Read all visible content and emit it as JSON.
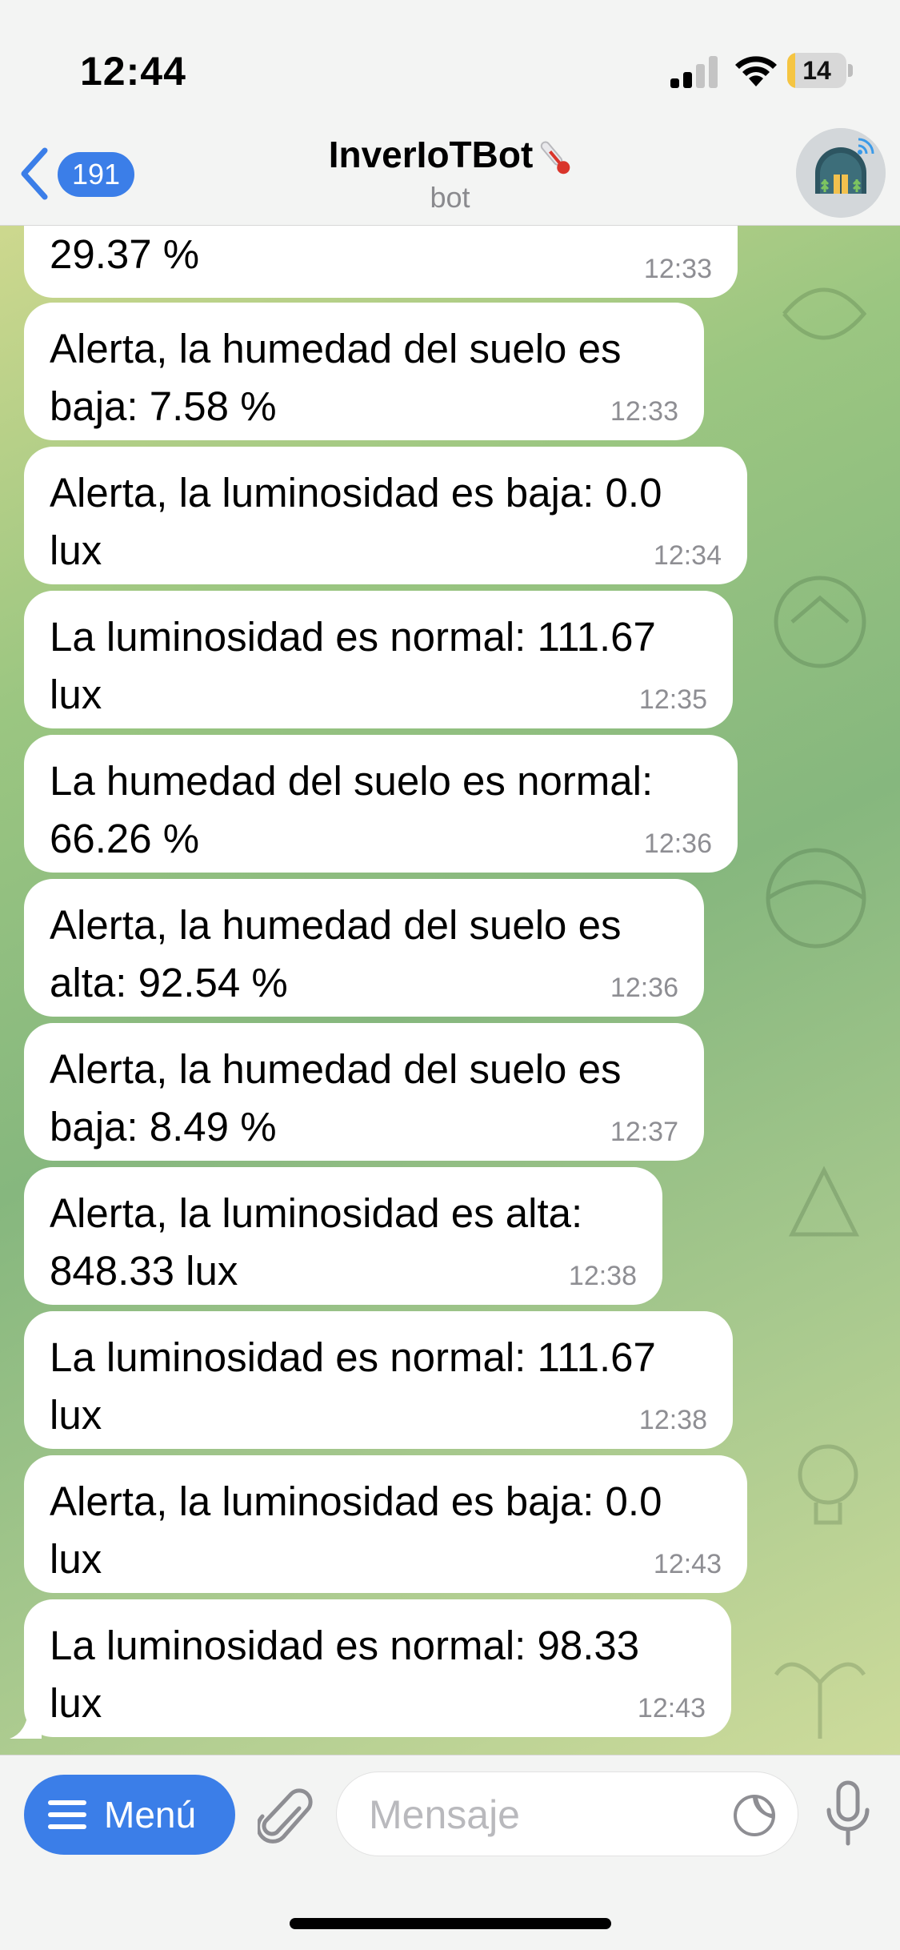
{
  "status_bar": {
    "time": "12:44",
    "battery": "14",
    "battery_level": 0.14,
    "icons": [
      "signal-icon",
      "wifi-icon",
      "battery-icon"
    ]
  },
  "header": {
    "back_count": "191",
    "title": "InverIoTBot",
    "subtitle": "bot",
    "icons": [
      "chevron-left-icon",
      "thermometer-icon",
      "greenhouse-avatar-icon"
    ]
  },
  "messages": [
    {
      "text": "29.37 %",
      "time": "12:33"
    },
    {
      "text": "Alerta, la humedad del suelo es\nbaja: 7.58 %",
      "time": "12:33"
    },
    {
      "text": "Alerta, la luminosidad es baja: 0.0\nlux",
      "time": "12:34"
    },
    {
      "text": "La luminosidad es normal: 111.67\nlux",
      "time": "12:35"
    },
    {
      "text": "La humedad del suelo es normal:\n66.26 %",
      "time": "12:36"
    },
    {
      "text": "Alerta, la humedad del suelo es\nalta: 92.54 %",
      "time": "12:36"
    },
    {
      "text": "Alerta, la humedad del suelo es\nbaja: 8.49 %",
      "time": "12:37"
    },
    {
      "text": "Alerta, la luminosidad es alta:\n848.33 lux",
      "time": "12:38"
    },
    {
      "text": "La luminosidad es normal: 111.67\nlux",
      "time": "12:38"
    },
    {
      "text": "Alerta, la luminosidad es baja: 0.0\nlux",
      "time": "12:43"
    },
    {
      "text": "La luminosidad es normal: 98.33\nlux",
      "time": "12:43"
    }
  ],
  "input_bar": {
    "menu_label": "Menú",
    "placeholder": "Mensaje",
    "icons": [
      "menu-icon",
      "paperclip-icon",
      "sticker-icon",
      "microphone-icon"
    ]
  },
  "colors": {
    "accent": "#3b7ee8",
    "bubble": "#ffffff",
    "timestamp": "#8e8e93",
    "battery_low": "#f5c542"
  }
}
